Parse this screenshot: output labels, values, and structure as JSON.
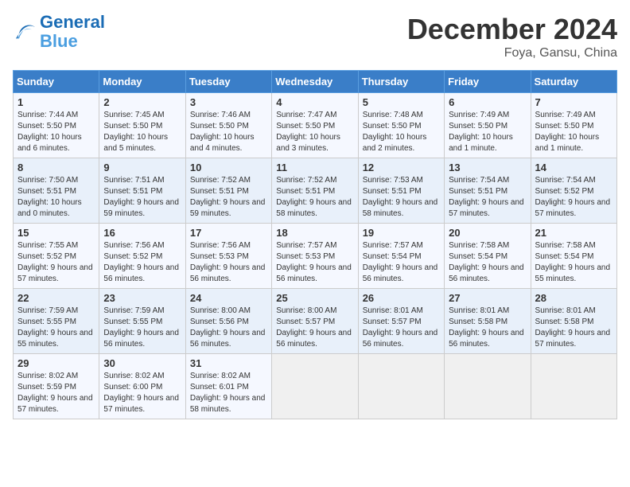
{
  "header": {
    "logo_line1": "General",
    "logo_line2": "Blue",
    "month": "December 2024",
    "location": "Foya, Gansu, China"
  },
  "weekdays": [
    "Sunday",
    "Monday",
    "Tuesday",
    "Wednesday",
    "Thursday",
    "Friday",
    "Saturday"
  ],
  "weeks": [
    [
      {
        "day": "1",
        "sunrise": "7:44 AM",
        "sunset": "5:50 PM",
        "daylight": "10 hours and 6 minutes."
      },
      {
        "day": "2",
        "sunrise": "7:45 AM",
        "sunset": "5:50 PM",
        "daylight": "10 hours and 5 minutes."
      },
      {
        "day": "3",
        "sunrise": "7:46 AM",
        "sunset": "5:50 PM",
        "daylight": "10 hours and 4 minutes."
      },
      {
        "day": "4",
        "sunrise": "7:47 AM",
        "sunset": "5:50 PM",
        "daylight": "10 hours and 3 minutes."
      },
      {
        "day": "5",
        "sunrise": "7:48 AM",
        "sunset": "5:50 PM",
        "daylight": "10 hours and 2 minutes."
      },
      {
        "day": "6",
        "sunrise": "7:49 AM",
        "sunset": "5:50 PM",
        "daylight": "10 hours and 1 minute."
      },
      {
        "day": "7",
        "sunrise": "7:49 AM",
        "sunset": "5:50 PM",
        "daylight": "10 hours and 1 minute."
      }
    ],
    [
      {
        "day": "8",
        "sunrise": "7:50 AM",
        "sunset": "5:51 PM",
        "daylight": "10 hours and 0 minutes."
      },
      {
        "day": "9",
        "sunrise": "7:51 AM",
        "sunset": "5:51 PM",
        "daylight": "9 hours and 59 minutes."
      },
      {
        "day": "10",
        "sunrise": "7:52 AM",
        "sunset": "5:51 PM",
        "daylight": "9 hours and 59 minutes."
      },
      {
        "day": "11",
        "sunrise": "7:52 AM",
        "sunset": "5:51 PM",
        "daylight": "9 hours and 58 minutes."
      },
      {
        "day": "12",
        "sunrise": "7:53 AM",
        "sunset": "5:51 PM",
        "daylight": "9 hours and 58 minutes."
      },
      {
        "day": "13",
        "sunrise": "7:54 AM",
        "sunset": "5:51 PM",
        "daylight": "9 hours and 57 minutes."
      },
      {
        "day": "14",
        "sunrise": "7:54 AM",
        "sunset": "5:52 PM",
        "daylight": "9 hours and 57 minutes."
      }
    ],
    [
      {
        "day": "15",
        "sunrise": "7:55 AM",
        "sunset": "5:52 PM",
        "daylight": "9 hours and 57 minutes."
      },
      {
        "day": "16",
        "sunrise": "7:56 AM",
        "sunset": "5:52 PM",
        "daylight": "9 hours and 56 minutes."
      },
      {
        "day": "17",
        "sunrise": "7:56 AM",
        "sunset": "5:53 PM",
        "daylight": "9 hours and 56 minutes."
      },
      {
        "day": "18",
        "sunrise": "7:57 AM",
        "sunset": "5:53 PM",
        "daylight": "9 hours and 56 minutes."
      },
      {
        "day": "19",
        "sunrise": "7:57 AM",
        "sunset": "5:54 PM",
        "daylight": "9 hours and 56 minutes."
      },
      {
        "day": "20",
        "sunrise": "7:58 AM",
        "sunset": "5:54 PM",
        "daylight": "9 hours and 56 minutes."
      },
      {
        "day": "21",
        "sunrise": "7:58 AM",
        "sunset": "5:54 PM",
        "daylight": "9 hours and 55 minutes."
      }
    ],
    [
      {
        "day": "22",
        "sunrise": "7:59 AM",
        "sunset": "5:55 PM",
        "daylight": "9 hours and 55 minutes."
      },
      {
        "day": "23",
        "sunrise": "7:59 AM",
        "sunset": "5:55 PM",
        "daylight": "9 hours and 56 minutes."
      },
      {
        "day": "24",
        "sunrise": "8:00 AM",
        "sunset": "5:56 PM",
        "daylight": "9 hours and 56 minutes."
      },
      {
        "day": "25",
        "sunrise": "8:00 AM",
        "sunset": "5:57 PM",
        "daylight": "9 hours and 56 minutes."
      },
      {
        "day": "26",
        "sunrise": "8:01 AM",
        "sunset": "5:57 PM",
        "daylight": "9 hours and 56 minutes."
      },
      {
        "day": "27",
        "sunrise": "8:01 AM",
        "sunset": "5:58 PM",
        "daylight": "9 hours and 56 minutes."
      },
      {
        "day": "28",
        "sunrise": "8:01 AM",
        "sunset": "5:58 PM",
        "daylight": "9 hours and 57 minutes."
      }
    ],
    [
      {
        "day": "29",
        "sunrise": "8:02 AM",
        "sunset": "5:59 PM",
        "daylight": "9 hours and 57 minutes."
      },
      {
        "day": "30",
        "sunrise": "8:02 AM",
        "sunset": "6:00 PM",
        "daylight": "9 hours and 57 minutes."
      },
      {
        "day": "31",
        "sunrise": "8:02 AM",
        "sunset": "6:01 PM",
        "daylight": "9 hours and 58 minutes."
      },
      null,
      null,
      null,
      null
    ]
  ]
}
